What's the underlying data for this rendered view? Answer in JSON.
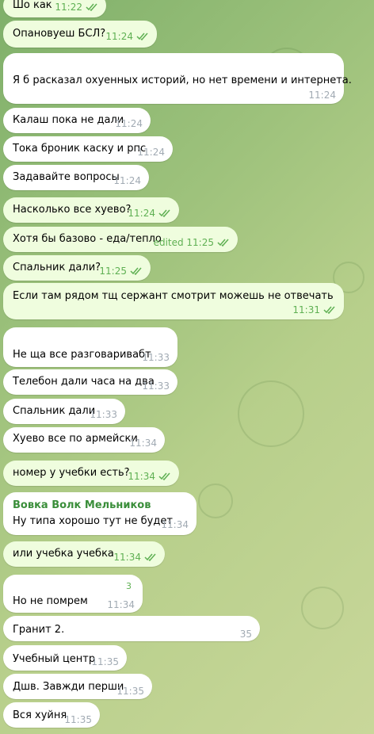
{
  "messages": [
    {
      "dir": "out",
      "text": "Шо как",
      "time": "11:22",
      "read": true
    },
    {
      "dir": "out",
      "text": "Опановуеш БСЛ?",
      "time": "11:24",
      "read": true
    },
    {
      "dir": "in",
      "text": "Я б расказал охуенных историй, но нет времени и интернета.",
      "time": "11:24"
    },
    {
      "dir": "in",
      "text": "Калаш пока не дали",
      "time": "11:24"
    },
    {
      "dir": "in",
      "text": "Тока броник каску и рпс",
      "time": "11:24"
    },
    {
      "dir": "in",
      "text": "Задавайте вопросы",
      "time": "11:24"
    },
    {
      "dir": "out",
      "text": "Насколько все хуево?",
      "time": "11:24",
      "read": true
    },
    {
      "dir": "out",
      "text": "Хотя бы базово - еда/тепло",
      "time": "edited 11:25",
      "read": true
    },
    {
      "dir": "out",
      "text": "Спальник дали?",
      "time": "11:25",
      "read": true
    },
    {
      "dir": "out",
      "text": "Если там рядом тщ сержант смотрит можешь не отвечать",
      "time": "11:31",
      "read": true
    },
    {
      "dir": "in",
      "text": "Не ща все разговаривабт",
      "time": "11:33"
    },
    {
      "dir": "in",
      "text": "Телебон дали часа на два",
      "time": "11:33"
    },
    {
      "dir": "in",
      "text": "Спальник дали",
      "time": "11:33"
    },
    {
      "dir": "in",
      "text": "Хуево все по армейски",
      "time": "11:34"
    },
    {
      "dir": "out",
      "text": "номер у учебки есть?",
      "time": "11:34",
      "read": true
    },
    {
      "dir": "in",
      "sender": "Вовка Волк Мельников",
      "text": "Ну типа хорошо тут не будет",
      "time": "11:34"
    },
    {
      "dir": "out",
      "text": "или учебка учебка",
      "time": "11:34",
      "read": true
    },
    {
      "dir": "in",
      "text": "Но не помрем",
      "time": "11:34",
      "extra": "3"
    },
    {
      "dir": "in",
      "text": "Гранит 2.",
      "time": "35"
    },
    {
      "dir": "in",
      "text": "Учебный центр",
      "time": "11:35"
    },
    {
      "dir": "in",
      "text": "Дшв. Завжди перши",
      "time": "11:35"
    },
    {
      "dir": "in",
      "text": "Вся хуйня",
      "time": "11:35"
    }
  ]
}
